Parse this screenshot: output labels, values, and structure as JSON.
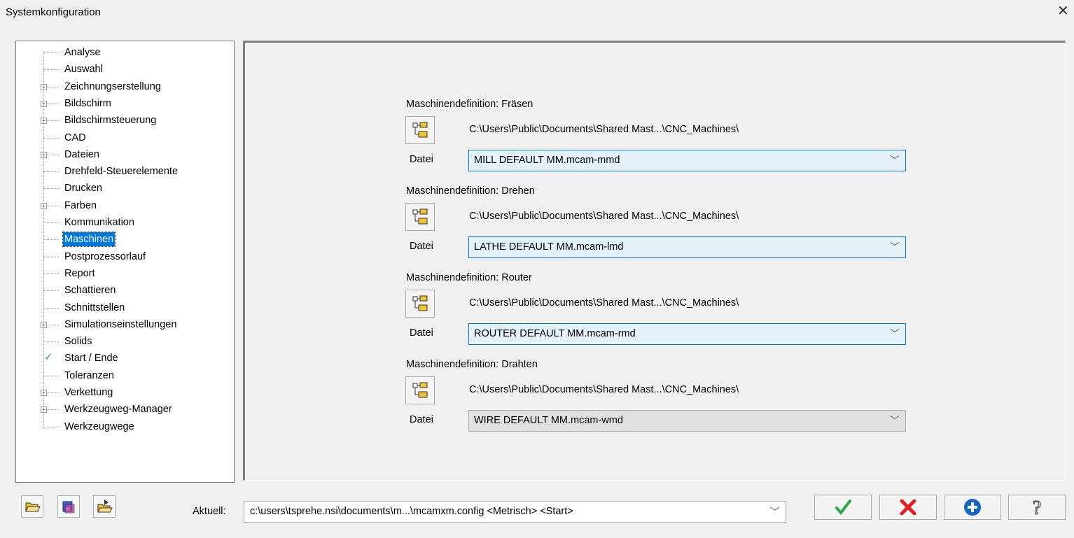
{
  "window": {
    "title": "Systemkonfiguration",
    "close_glyph": "✕"
  },
  "tree": {
    "items": [
      {
        "label": "Analyse",
        "expandable": false
      },
      {
        "label": "Auswahl",
        "expandable": false
      },
      {
        "label": "Zeichnungserstellung",
        "expandable": true
      },
      {
        "label": "Bildschirm",
        "expandable": true
      },
      {
        "label": "Bildschirmsteuerung",
        "expandable": true
      },
      {
        "label": "CAD",
        "expandable": false
      },
      {
        "label": "Dateien",
        "expandable": true
      },
      {
        "label": "Drehfeld-Steuerelemente",
        "expandable": false
      },
      {
        "label": "Drucken",
        "expandable": false
      },
      {
        "label": "Farben",
        "expandable": true
      },
      {
        "label": "Kommunikation",
        "expandable": false
      },
      {
        "label": "Maschinen",
        "expandable": false,
        "selected": true
      },
      {
        "label": "Postprozessorlauf",
        "expandable": false
      },
      {
        "label": "Report",
        "expandable": false
      },
      {
        "label": "Schattieren",
        "expandable": false
      },
      {
        "label": "Schnittstellen",
        "expandable": false
      },
      {
        "label": "Simulationseinstellungen",
        "expandable": true
      },
      {
        "label": "Solids",
        "expandable": false
      },
      {
        "label": "Start / Ende",
        "expandable": false,
        "checked": true
      },
      {
        "label": "Toleranzen",
        "expandable": false
      },
      {
        "label": "Verkettung",
        "expandable": true
      },
      {
        "label": "Werkzeugweg-Manager",
        "expandable": true
      },
      {
        "label": "Werkzeugwege",
        "expandable": false
      }
    ]
  },
  "machines": [
    {
      "title": "Maschinendefinition: Fräsen",
      "path": "C:\\Users\\Public\\Documents\\Shared Mast...\\CNC_Machines\\",
      "file_label": "Datei",
      "file": "MILL DEFAULT MM.mcam-mmd",
      "enabled": true
    },
    {
      "title": "Maschinendefinition: Drehen",
      "path": "C:\\Users\\Public\\Documents\\Shared Mast...\\CNC_Machines\\",
      "file_label": "Datei",
      "file": "LATHE DEFAULT MM.mcam-lmd",
      "enabled": true
    },
    {
      "title": "Maschinendefinition: Router",
      "path": "C:\\Users\\Public\\Documents\\Shared Mast...\\CNC_Machines\\",
      "file_label": "Datei",
      "file": "ROUTER DEFAULT MM.mcam-rmd",
      "enabled": true
    },
    {
      "title": "Maschinendefinition: Drahten",
      "path": "C:\\Users\\Public\\Documents\\Shared Mast...\\CNC_Machines\\",
      "file_label": "Datei",
      "file": "WIRE DEFAULT MM.mcam-wmd",
      "enabled": false
    }
  ],
  "footer": {
    "aktuell_label": "Aktuell:",
    "aktuell_value": "c:\\users\\tsprehe.nsi\\documents\\m...\\mcamxm.config <Metrisch> <Start>",
    "buttons": [
      "open-folder-icon",
      "save-icon",
      "open-file-icon"
    ],
    "actions": [
      {
        "name": "ok-button",
        "icon": "checkmark-icon",
        "color": "#2ea44f"
      },
      {
        "name": "cancel-button",
        "icon": "x-icon",
        "color": "#e02020"
      },
      {
        "name": "apply-button",
        "icon": "plus-circle-icon",
        "color": "#1565c0"
      },
      {
        "name": "help-button",
        "icon": "question-icon",
        "color": "#666666"
      }
    ]
  }
}
